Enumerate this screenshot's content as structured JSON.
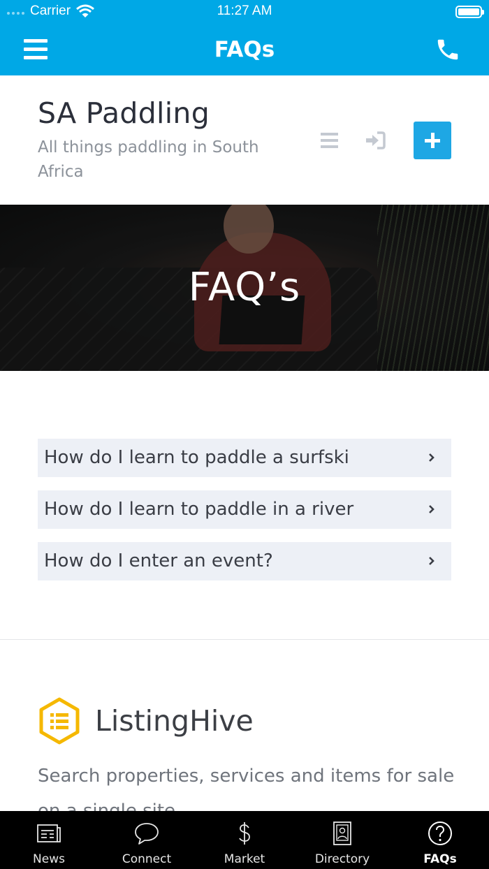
{
  "status_bar": {
    "carrier": "Carrier",
    "time": "11:27 AM"
  },
  "nav": {
    "title": "FAQs"
  },
  "header": {
    "site_title": "SA Paddling",
    "tagline": "All things paddling in South Africa"
  },
  "hero": {
    "title": "FAQ’s"
  },
  "faqs": [
    {
      "question": "How do I learn to paddle a surfski"
    },
    {
      "question": "How do I learn to paddle in a river"
    },
    {
      "question": "How do I enter an event?"
    }
  ],
  "brand": {
    "name": "ListingHive",
    "description": "Search properties, services and items for sale on a single site."
  },
  "tabs": [
    {
      "label": "News",
      "icon": "news-icon",
      "active": false
    },
    {
      "label": "Connect",
      "icon": "chat-bubble-icon",
      "active": false
    },
    {
      "label": "Market",
      "icon": "dollar-icon",
      "active": false
    },
    {
      "label": "Directory",
      "icon": "contact-book-icon",
      "active": false
    },
    {
      "label": "FAQs",
      "icon": "question-circle-icon",
      "active": true
    }
  ],
  "colors": {
    "accent": "#00A8E6",
    "add_button": "#1EA7E4",
    "faq_bg": "#EDF0F6",
    "logo": "#F5B800"
  }
}
